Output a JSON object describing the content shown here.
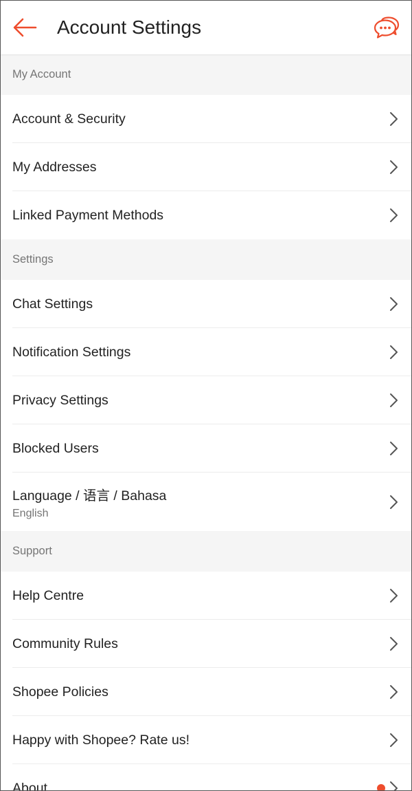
{
  "header": {
    "title": "Account Settings",
    "back_icon": "arrow-left-icon",
    "chat_icon": "chat-bubbles-icon"
  },
  "colors": {
    "accent": "#ee4d2d",
    "section_bg": "#f5f5f5",
    "muted_text": "#757575",
    "divider": "#ececec"
  },
  "sections": [
    {
      "title": "My Account",
      "items": [
        {
          "label": "Account & Security"
        },
        {
          "label": "My Addresses"
        },
        {
          "label": "Linked Payment Methods"
        }
      ]
    },
    {
      "title": "Settings",
      "items": [
        {
          "label": "Chat Settings"
        },
        {
          "label": "Notification Settings"
        },
        {
          "label": "Privacy Settings"
        },
        {
          "label": "Blocked Users"
        },
        {
          "label": "Language / 语言 / Bahasa",
          "sub": "English"
        }
      ]
    },
    {
      "title": "Support",
      "items": [
        {
          "label": "Help Centre"
        },
        {
          "label": "Community Rules"
        },
        {
          "label": "Shopee Policies"
        },
        {
          "label": "Happy with Shopee? Rate us!"
        },
        {
          "label": "About",
          "has_dot": true
        }
      ]
    }
  ]
}
